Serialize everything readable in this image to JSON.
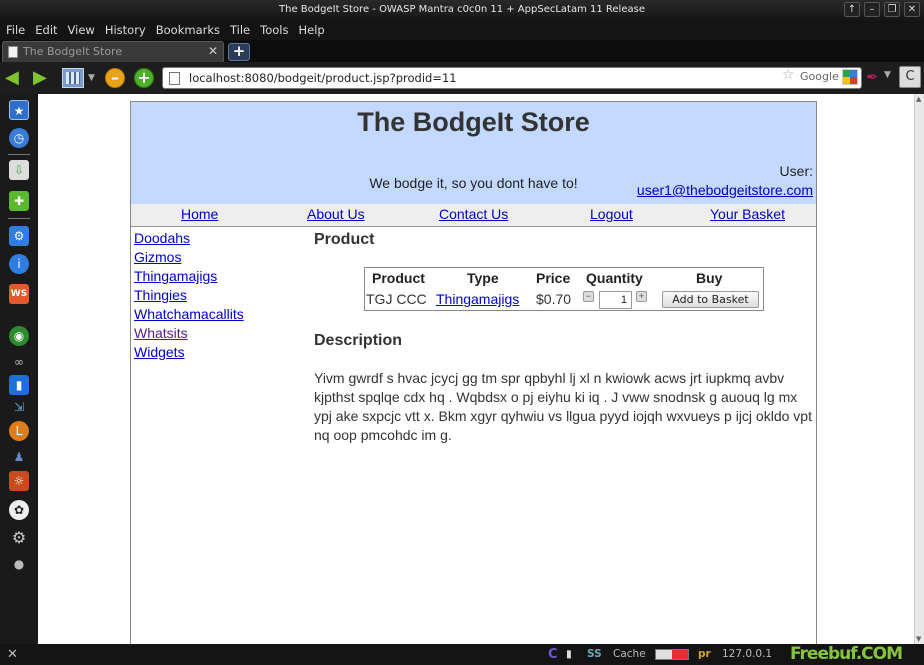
{
  "window": {
    "title": "The BodgeIt Store - OWASP Mantra c0c0n 11 + AppSecLatam 11 Release",
    "controls": [
      "↑",
      "–",
      "❐",
      "✕"
    ]
  },
  "menu": [
    "File",
    "Edit",
    "View",
    "History",
    "Bookmarks",
    "Tile",
    "Tools",
    "Help"
  ],
  "tab": {
    "label": "The BodgeIt Store",
    "close": "✕",
    "new": "+"
  },
  "nav": {
    "url": "localhost:8080/bodgeit/product.jsp?prodid=11",
    "search_placeholder": "Google",
    "reload": "C"
  },
  "store": {
    "title": "The BodgeIt Store",
    "tagline": "We bodge it, so you dont have to!",
    "user_label": "User:",
    "user_email": "user1@thebodgeitstore.com",
    "nav_links": [
      "Home",
      "About Us",
      "Contact Us",
      "Logout",
      "Your Basket"
    ],
    "categories": [
      "Doodahs",
      "Gizmos",
      "Thingamajigs",
      "Thingies",
      "Whatchamacallits",
      "Whatsits",
      "Widgets"
    ],
    "product_heading": "Product",
    "table": {
      "headers": [
        "Product",
        "Type",
        "Price",
        "Quantity",
        "Buy"
      ],
      "row": {
        "product": "TGJ CCC",
        "type": "Thingamajigs",
        "price": "$0.70",
        "quantity": "1",
        "buy_label": "Add to Basket"
      }
    },
    "description_heading": "Description",
    "description": "Yivm gwrdf s hvac jcycj gg tm spr qpbyhl lj xl n kwiowk acws jrt iupkmq avbv kjpthst spqlqe cdx hq . Wqbdsx o pj eiyhu ki iq . J vww snodnsk g auouq lg mx ypj ake sxpcjc vtt x. Bkm xgyr qyhwiu vs llgua pyyd iojqh wxvueys p ijcj okldo vpt nq oop pmcohdc im g."
  },
  "status": {
    "close": "✕",
    "ss": "SS",
    "cache": "Cache",
    "pr": "pr",
    "ip": "127.0.0.1",
    "watermark": "Freebuf.COM"
  }
}
